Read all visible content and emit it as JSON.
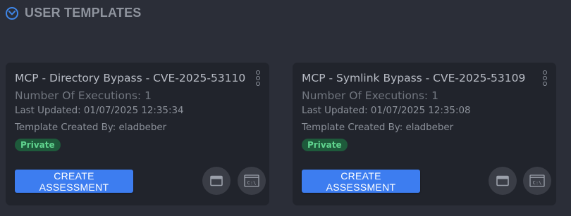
{
  "section": {
    "title": "USER TEMPLATES",
    "toggle_icon": "chevron-down-circle-icon",
    "accent_color": "#3f86e8"
  },
  "cards": [
    {
      "title": "MCP - Directory Bypass - CVE-2025-53110",
      "executions": "Number Of Executions: 1",
      "last_updated": "Last Updated: 01/07/2025 12:35:34",
      "created_by": "Template Created By: eladbeber",
      "badge": "Private",
      "create_button": "CREATE ASSESSMENT",
      "icons": [
        "window-icon",
        "terminal-icon"
      ],
      "terminal_glyph": "C:\\"
    },
    {
      "title": "MCP - Symlink Bypass - CVE-2025-53109",
      "executions": "Number Of Executions: 1",
      "last_updated": "Last Updated: 01/07/2025 12:35:08",
      "created_by": "Template Created By: eladbeber",
      "badge": "Private",
      "create_button": "CREATE ASSESSMENT",
      "icons": [
        "window-icon",
        "terminal-icon"
      ],
      "terminal_glyph": "C:\\"
    }
  ],
  "colors": {
    "background": "#2b2e38",
    "card": "#21242c",
    "primary_button": "#3d7df0",
    "badge_bg": "#1e5a3b",
    "badge_text": "#5fd38e"
  }
}
